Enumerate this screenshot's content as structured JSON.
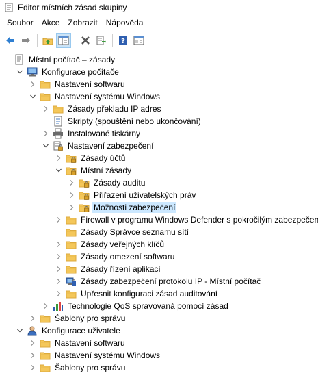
{
  "window": {
    "title": "Editor místních zásad skupiny"
  },
  "menu": [
    {
      "label": "Soubor"
    },
    {
      "label": "Akce"
    },
    {
      "label": "Zobrazit"
    },
    {
      "label": "Nápověda"
    }
  ],
  "toolbar": {
    "buttons": [
      {
        "name": "back-button",
        "icon": "back-arrow-icon"
      },
      {
        "name": "forward-button",
        "icon": "forward-arrow-icon"
      },
      {
        "name": "up-folder-button",
        "icon": "folder-up-icon"
      },
      {
        "name": "show-hide-tree-button",
        "icon": "console-tree-icon"
      },
      {
        "name": "delete-button",
        "icon": "delete-x-icon"
      },
      {
        "name": "export-list-button",
        "icon": "export-icon"
      },
      {
        "name": "help-button",
        "icon": "help-icon"
      },
      {
        "name": "properties-button",
        "icon": "properties-icon"
      }
    ]
  },
  "tree": {
    "items": [
      {
        "label": "Místní počítač – zásady",
        "icon": "policy-document-icon",
        "expander": "none"
      },
      {
        "label": "Konfigurace počítače",
        "icon": "computer-icon",
        "expander": "expanded"
      },
      {
        "label": "Nastavení softwaru",
        "icon": "folder-icon",
        "expander": "collapsed"
      },
      {
        "label": "Nastavení systému Windows",
        "icon": "folder-icon",
        "expander": "expanded"
      },
      {
        "label": "Zásady překladu IP adres",
        "icon": "folder-icon",
        "expander": "collapsed"
      },
      {
        "label": "Skripty (spouštění nebo ukončování)",
        "icon": "script-icon",
        "expander": "none"
      },
      {
        "label": "Instalované tiskárny",
        "icon": "printer-icon",
        "expander": "collapsed"
      },
      {
        "label": "Nastavení zabezpečení",
        "icon": "security-settings-icon",
        "expander": "expanded"
      },
      {
        "label": "Zásady účtů",
        "icon": "locked-folder-icon",
        "expander": "collapsed"
      },
      {
        "label": "Místní zásady",
        "icon": "locked-folder-icon",
        "expander": "expanded"
      },
      {
        "label": "Zásady auditu",
        "icon": "locked-folder-icon",
        "expander": "collapsed"
      },
      {
        "label": "Přiřazení uživatelských práv",
        "icon": "locked-folder-icon",
        "expander": "collapsed"
      },
      {
        "label": "Možnosti zabezpečení",
        "icon": "locked-folder-icon",
        "expander": "collapsed",
        "selected": true
      },
      {
        "label": "Firewall v programu Windows Defender s pokročilým zabezpečením",
        "icon": "folder-icon",
        "expander": "collapsed"
      },
      {
        "label": "Zásady Správce seznamu sítí",
        "icon": "folder-icon",
        "expander": "none"
      },
      {
        "label": "Zásady veřejných klíčů",
        "icon": "folder-icon",
        "expander": "collapsed"
      },
      {
        "label": "Zásady omezení softwaru",
        "icon": "folder-icon",
        "expander": "collapsed"
      },
      {
        "label": "Zásady řízení aplikací",
        "icon": "folder-icon",
        "expander": "collapsed"
      },
      {
        "label": "Zásady zabezpečení protokolu IP - Místní počítač",
        "icon": "ip-security-icon",
        "expander": "collapsed"
      },
      {
        "label": "Upřesnit konfiguraci zásad auditování",
        "icon": "folder-icon",
        "expander": "collapsed"
      },
      {
        "label": "Technologie QoS spravovaná pomocí zásad",
        "icon": "qos-chart-icon",
        "expander": "collapsed"
      },
      {
        "label": "Šablony pro správu",
        "icon": "folder-icon",
        "expander": "collapsed"
      },
      {
        "label": "Konfigurace uživatele",
        "icon": "user-icon",
        "expander": "expanded"
      },
      {
        "label": "Nastavení softwaru",
        "icon": "folder-icon",
        "expander": "collapsed"
      },
      {
        "label": "Nastavení systému Windows",
        "icon": "folder-icon",
        "expander": "collapsed"
      },
      {
        "label": "Šablony pro správu",
        "icon": "folder-icon",
        "expander": "collapsed"
      }
    ]
  },
  "colors": {
    "selection": "#cce8ff",
    "folder": "#f4c75a",
    "folder_dark": "#dcaa3c"
  }
}
